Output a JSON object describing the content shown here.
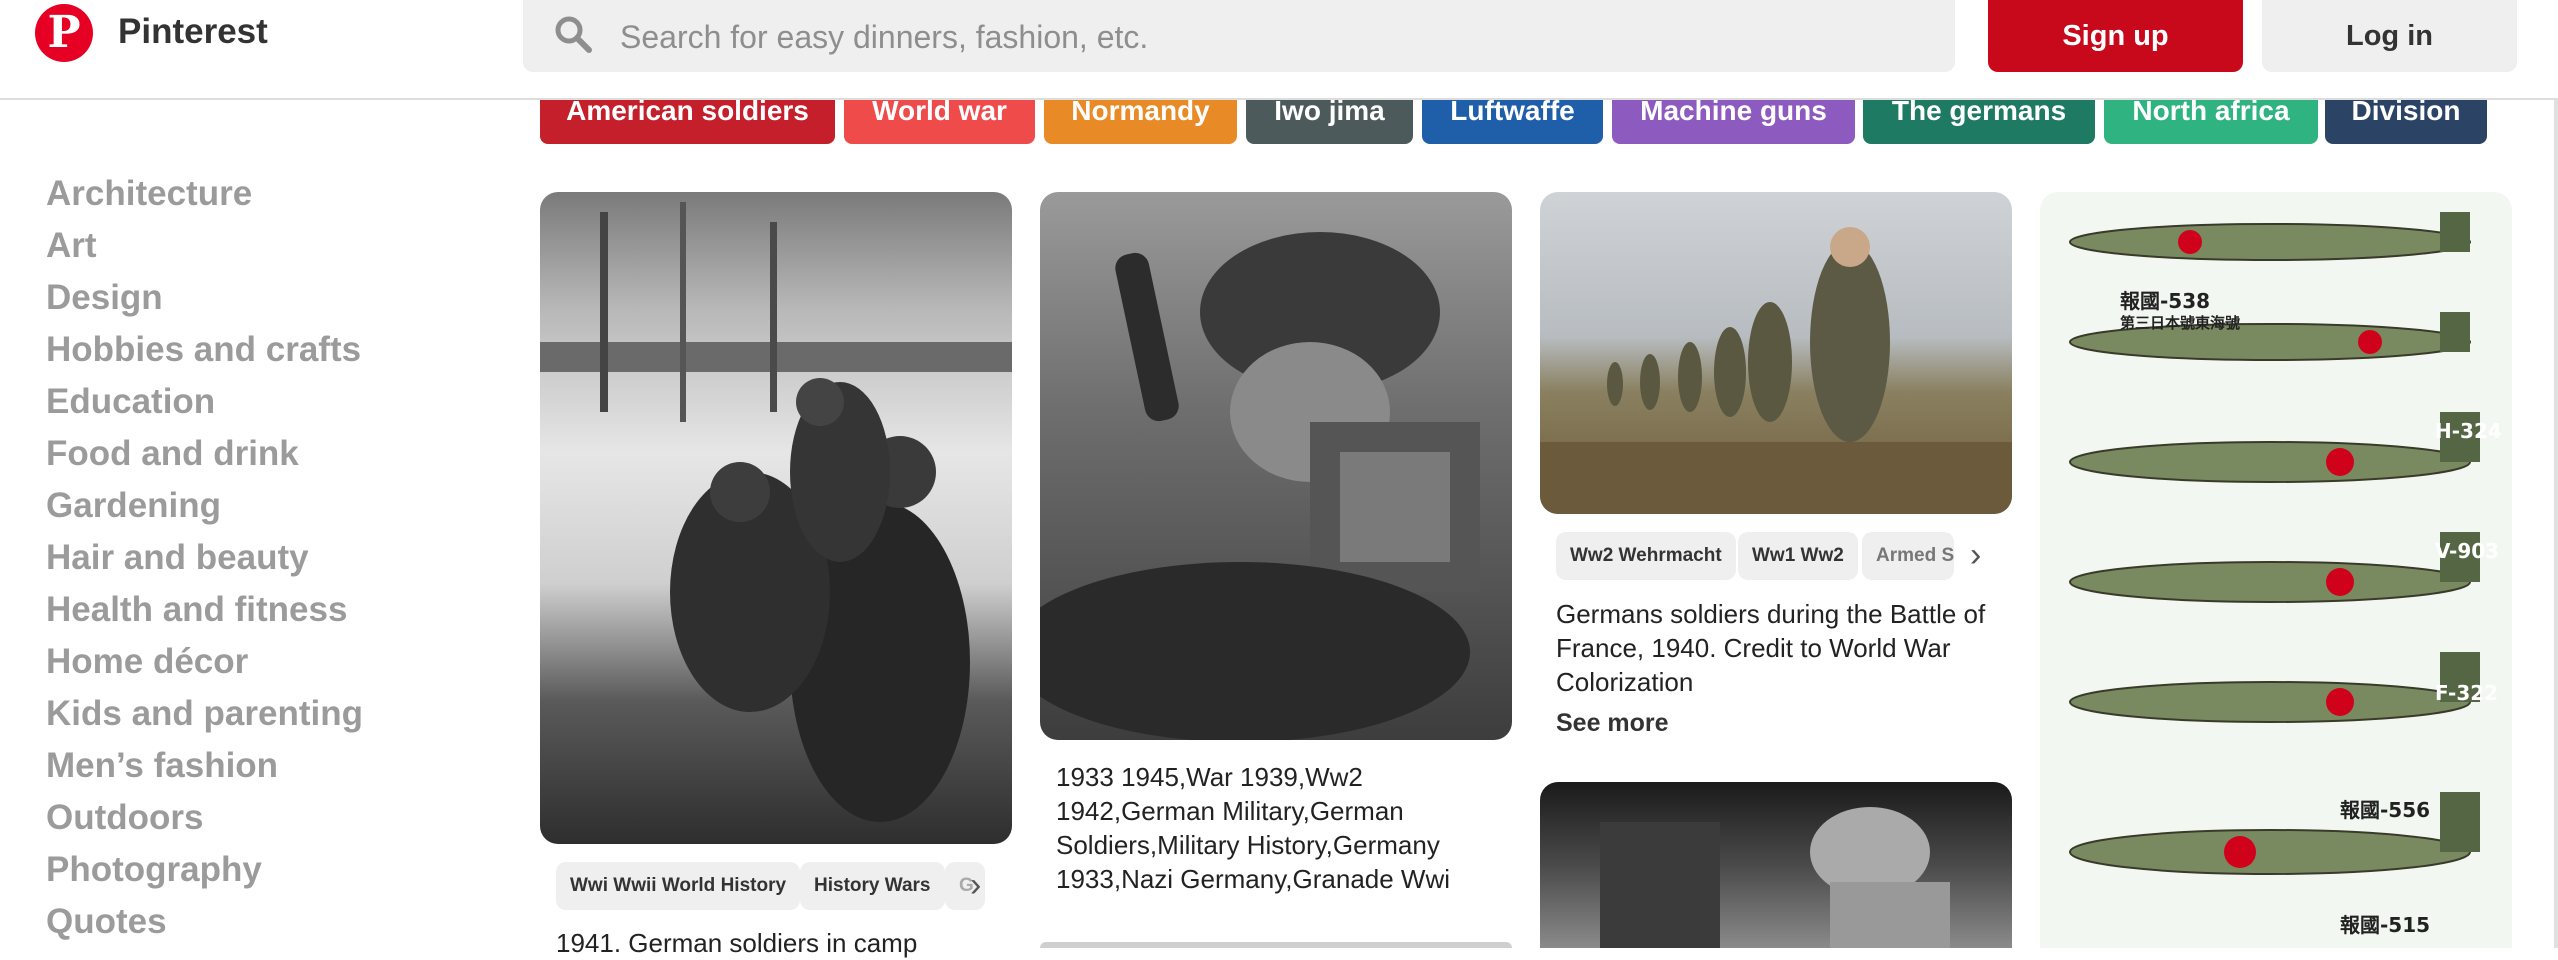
{
  "header": {
    "brand": "Pinterest",
    "search_placeholder": "Search for easy dinners, fashion, etc.",
    "signup_label": "Sign up",
    "login_label": "Log in",
    "brand_color": "#e60023"
  },
  "chips": [
    {
      "label": "American soldiers",
      "color": "#c51f2b"
    },
    {
      "label": "World war",
      "color": "#ef4b4b"
    },
    {
      "label": "Normandy",
      "color": "#e88a26"
    },
    {
      "label": "Iwo jima",
      "color": "#4d5a5b"
    },
    {
      "label": "Luftwaffe",
      "color": "#1f5ea8"
    },
    {
      "label": "Machine guns",
      "color": "#8d5ac0"
    },
    {
      "label": "The germans",
      "color": "#1f7a64"
    },
    {
      "label": "North africa",
      "color": "#2eb381"
    },
    {
      "label": "Division",
      "color": "#2b4466"
    }
  ],
  "sidebar": {
    "categories": [
      "Architecture",
      "Art",
      "Design",
      "Hobbies and crafts",
      "Education",
      "Food and drink",
      "Gardening",
      "Hair and beauty",
      "Health and fitness",
      "Home décor",
      "Kids and parenting",
      "Men’s fashion",
      "Outdoors",
      "Photography",
      "Quotes"
    ]
  },
  "pins": {
    "pin1": {
      "tags": [
        "Wwi Wwii World History",
        "History Wars",
        "G"
      ],
      "description": "1941. German soldiers in camp"
    },
    "pin2": {
      "description": "1933 1945,War 1939,Ww2 1942,German Military,German Soldiers,Military History,Germany 1933,Nazi Germany,Granade Wwi"
    },
    "pin3": {
      "tags": [
        "Ww2 Wehrmacht",
        "Ww1 Ww2",
        "Armed Se"
      ],
      "description": "Germans soldiers during the Battle of France, 1940. Credit to World War Colorization",
      "see_more": "See more"
    },
    "pin4": {
      "aircraft_labels": [
        "報國-538",
        "第三日本號東海號",
        "H-324",
        "V-903",
        "F-322",
        "報國-556",
        "報國-515"
      ]
    }
  }
}
